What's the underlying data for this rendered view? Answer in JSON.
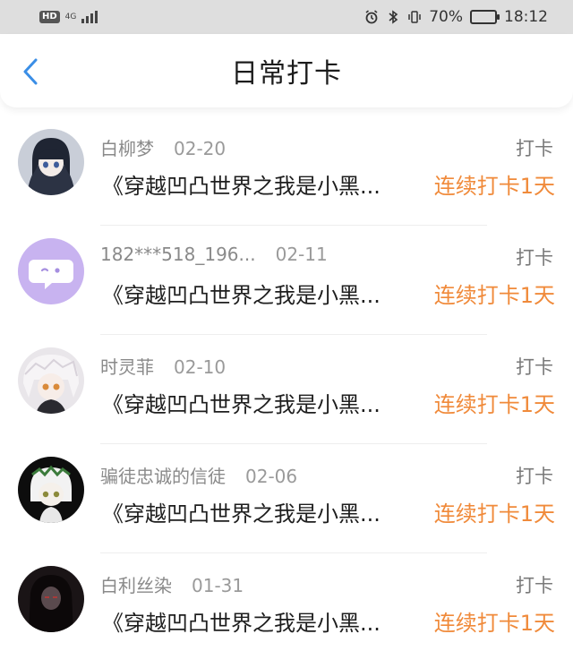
{
  "status_bar": {
    "hd": "HD",
    "network": "4G",
    "battery_percent": "70%",
    "battery_level": 0.7,
    "time": "18:12",
    "icons": [
      "alarm-icon",
      "bluetooth-icon",
      "vibrate-icon",
      "battery-icon"
    ]
  },
  "header": {
    "title": "日常打卡",
    "back_icon": "chevron-left-icon",
    "accent": "#3a8ee6"
  },
  "colors": {
    "streak": "#f08a3a",
    "meta": "#8a8a8a"
  },
  "items": [
    {
      "name": "白柳梦",
      "date": "02-20",
      "type": "打卡",
      "book": "《穿越凹凸世界之我是小黑...",
      "streak": "连续打卡1天",
      "avatar": "dark-haired-girl-avatar"
    },
    {
      "name": "182***518_196...",
      "date": "02-11",
      "type": "打卡",
      "book": "《穿越凹凸世界之我是小黑...",
      "streak": "连续打卡1天",
      "avatar": "default-chat-bubble-avatar"
    },
    {
      "name": "时灵菲",
      "date": "02-10",
      "type": "打卡",
      "book": "《穿越凹凸世界之我是小黑...",
      "streak": "连续打卡1天",
      "avatar": "white-haired-anime-avatar"
    },
    {
      "name": "骗徒忠诚的信徒",
      "date": "02-06",
      "type": "打卡",
      "book": "《穿越凹凸世界之我是小黑...",
      "streak": "连续打卡1天",
      "avatar": "maid-character-avatar"
    },
    {
      "name": "白利丝染",
      "date": "01-31",
      "type": "打卡",
      "book": "《穿越凹凸世界之我是小黑...",
      "streak": "连续打卡1天",
      "avatar": "dark-portrait-avatar"
    }
  ]
}
